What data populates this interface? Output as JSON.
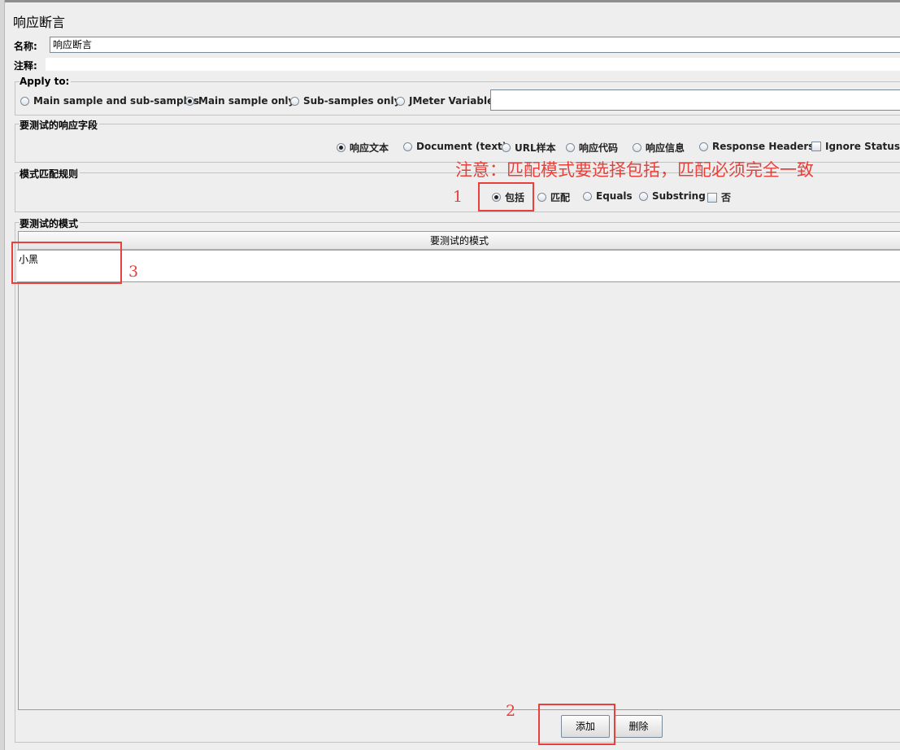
{
  "panel": {
    "title": "响应断言",
    "name_label": "名称:",
    "name_value": "响应断言",
    "comment_label": "注释:",
    "comment_value": ""
  },
  "apply_to": {
    "legend": "Apply to:",
    "options": [
      "Main sample and sub-samples",
      "Main sample only",
      "Sub-samples only",
      "JMeter Variable"
    ],
    "selected": "Main sample only",
    "variable_value": ""
  },
  "response_field": {
    "legend": "要测试的响应字段",
    "options": [
      "响应文本",
      "Document (text)",
      "URL样本",
      "响应代码",
      "响应信息",
      "Response Headers"
    ],
    "selected": "响应文本",
    "ignore_status_label": "Ignore Status",
    "ignore_status_checked": false
  },
  "pattern_rule": {
    "legend": "模式匹配规则",
    "options": [
      "包括",
      "匹配",
      "Equals",
      "Substring"
    ],
    "selected": "包括",
    "not_label": "否",
    "not_checked": false
  },
  "patterns": {
    "legend": "要测试的模式",
    "column_header": "要测试的模式",
    "rows": [
      "小黑"
    ]
  },
  "buttons": {
    "add": "添加",
    "delete": "删除"
  },
  "annotations": {
    "note": "注意：匹配模式要选择包括，匹配必须完全一致",
    "marker_1": "1",
    "marker_2": "2",
    "marker_3": "3",
    "color": "#e8403a"
  }
}
